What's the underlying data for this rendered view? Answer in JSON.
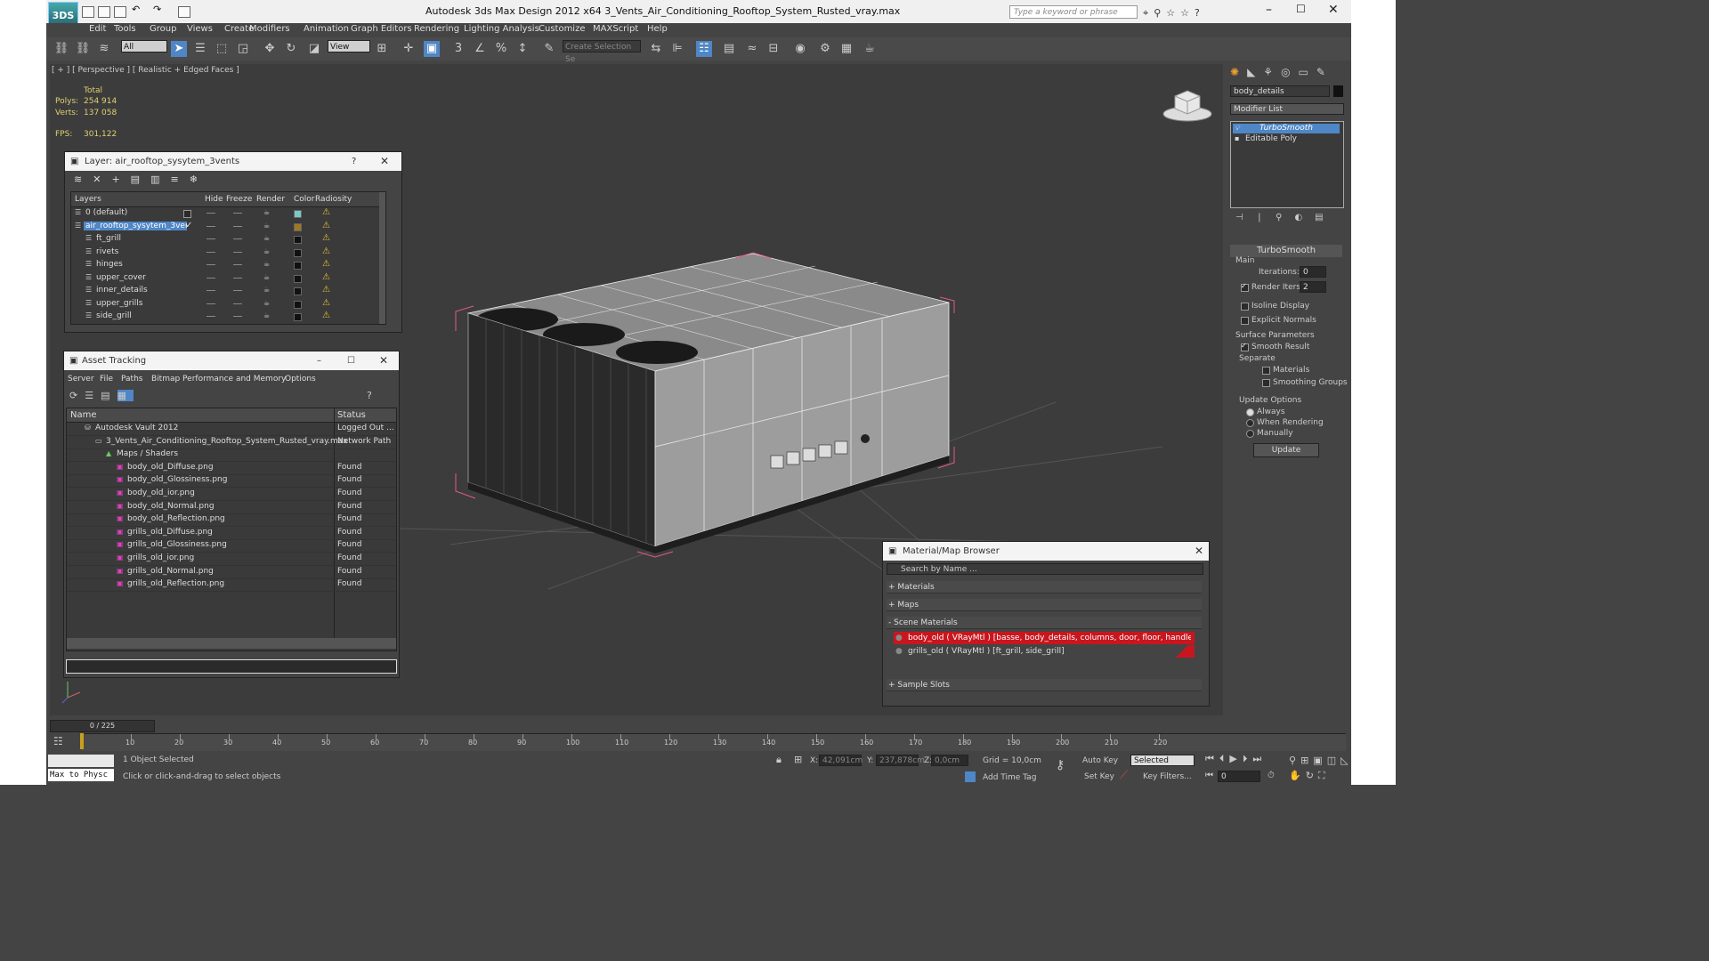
{
  "app": {
    "title": "Autodesk 3ds Max Design 2012 x64    3_Vents_Air_Conditioning_Rooftop_System_Rusted_vray.max",
    "logo": "3DS",
    "search_placeholder": "Type a keyword or phrase"
  },
  "menu": [
    "Edit",
    "Tools",
    "Group",
    "Views",
    "Create",
    "Modifiers",
    "Animation",
    "Graph Editors",
    "Rendering",
    "Lighting Analysis",
    "Customize",
    "MAXScript",
    "Help"
  ],
  "toolbar": {
    "filter_value": "All",
    "refcoord_value": "View",
    "selection_set_placeholder": "Create Selection Se"
  },
  "viewport": {
    "label": "[ + ] [ Perspective ] [ Realistic + Edged Faces ]",
    "stats_header": "Total",
    "polys_label": "Polys:",
    "polys_value": "254 914",
    "verts_label": "Verts:",
    "verts_value": "137 058",
    "fps_label": "FPS:",
    "fps_value": "301,122"
  },
  "layer_panel": {
    "title": "Layer: air_rooftop_sysytem_3vents",
    "help": "?",
    "columns": [
      "Layers",
      "Hide",
      "Freeze",
      "Render",
      "Color",
      "Radiosity"
    ],
    "rows": [
      {
        "name": "0 (default)",
        "color": "#7ec7c7"
      },
      {
        "name": "air_rooftop_sysytem_3vents",
        "color": "#a07820",
        "selected": true
      },
      {
        "name": "ft_grill",
        "color": "#111111"
      },
      {
        "name": "rivets",
        "color": "#111111"
      },
      {
        "name": "hinges",
        "color": "#111111"
      },
      {
        "name": "upper_cover",
        "color": "#111111"
      },
      {
        "name": "inner_details",
        "color": "#111111"
      },
      {
        "name": "upper_grills",
        "color": "#111111"
      },
      {
        "name": "side_grill",
        "color": "#111111"
      }
    ]
  },
  "asset_panel": {
    "title": "Asset Tracking",
    "menu": [
      "Server",
      "File",
      "Paths",
      "Bitmap Performance and Memory",
      "Options"
    ],
    "columns": [
      "Name",
      "Status"
    ],
    "rows": [
      {
        "name": "Autodesk Vault 2012",
        "status": "Logged Out ...",
        "indent": 1,
        "icon": "vault"
      },
      {
        "name": "3_Vents_Air_Conditioning_Rooftop_System_Rusted_vray.max",
        "status": "Network Path",
        "indent": 2,
        "icon": "file"
      },
      {
        "name": "Maps / Shaders",
        "status": "",
        "indent": 3,
        "icon": "maps"
      },
      {
        "name": "body_old_Diffuse.png",
        "status": "Found",
        "indent": 4,
        "icon": "png"
      },
      {
        "name": "body_old_Glossiness.png",
        "status": "Found",
        "indent": 4,
        "icon": "png"
      },
      {
        "name": "body_old_ior.png",
        "status": "Found",
        "indent": 4,
        "icon": "png"
      },
      {
        "name": "body_old_Normal.png",
        "status": "Found",
        "indent": 4,
        "icon": "png"
      },
      {
        "name": "body_old_Reflection.png",
        "status": "Found",
        "indent": 4,
        "icon": "png"
      },
      {
        "name": "grills_old_Diffuse.png",
        "status": "Found",
        "indent": 4,
        "icon": "png"
      },
      {
        "name": "grills_old_Glossiness.png",
        "status": "Found",
        "indent": 4,
        "icon": "png"
      },
      {
        "name": "grills_old_ior.png",
        "status": "Found",
        "indent": 4,
        "icon": "png"
      },
      {
        "name": "grills_old_Normal.png",
        "status": "Found",
        "indent": 4,
        "icon": "png"
      },
      {
        "name": "grills_old_Reflection.png",
        "status": "Found",
        "indent": 4,
        "icon": "png"
      }
    ]
  },
  "command_panel": {
    "object_name": "body_details",
    "modifier_list_label": "Modifier List",
    "stack": [
      "TurboSmooth",
      "Editable Poly"
    ],
    "rollout_title": "TurboSmooth",
    "main_label": "Main",
    "iterations_label": "Iterations:",
    "iterations_value": "0",
    "render_iters_label": "Render Iters:",
    "render_iters_value": "2",
    "isoline_label": "Isoline Display",
    "explicit_normals_label": "Explicit Normals",
    "surface_params_label": "Surface Parameters",
    "smooth_result_label": "Smooth Result",
    "separate_label": "Separate",
    "materials_label": "Materials",
    "smoothing_groups_label": "Smoothing Groups",
    "update_options_label": "Update Options",
    "always_label": "Always",
    "when_rendering_label": "When Rendering",
    "manually_label": "Manually",
    "update_button": "Update"
  },
  "material_browser": {
    "title": "Material/Map Browser",
    "search_placeholder": "Search by Name ...",
    "sections": [
      "+ Materials",
      "+ Maps",
      "- Scene Materials",
      "+ Sample Slots"
    ],
    "materials": [
      {
        "label": "body_old ( VRayMtl ) [basse, body_details, columns, door, floor, handle, hinges...",
        "selected": true
      },
      {
        "label": "grills_old ( VRayMtl ) [ft_grill, side_grill]",
        "selected": false
      }
    ]
  },
  "timeline": {
    "frame_display": "0 / 225",
    "ticks": [
      "10",
      "20",
      "30",
      "40",
      "50",
      "60",
      "70",
      "80",
      "90",
      "100",
      "110",
      "120",
      "130",
      "140",
      "150",
      "160",
      "170",
      "180",
      "190",
      "200",
      "210",
      "220"
    ]
  },
  "status": {
    "maxscript_listener": "Max to Physc",
    "selected_text": "1 Object Selected",
    "prompt_text": "Click or click-and-drag to select objects",
    "x_label": "X:",
    "x_value": "42,091cm",
    "y_label": "Y:",
    "y_value": "237,878cm",
    "z_label": "Z:",
    "z_value": "0,0cm",
    "grid_text": "Grid = 10,0cm",
    "add_time_tag": "Add Time Tag",
    "auto_key": "Auto Key",
    "set_key": "Set Key",
    "key_mode_value": "Selected",
    "key_filters": "Key Filters...",
    "frame_value": "0"
  }
}
